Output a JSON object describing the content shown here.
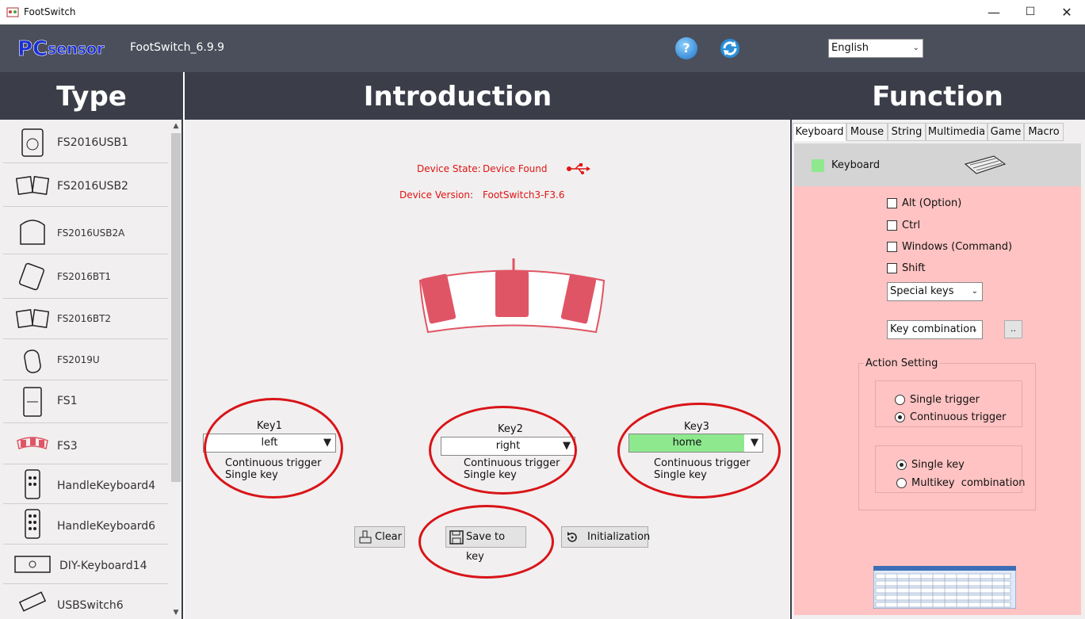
{
  "window": {
    "title": "FootSwitch",
    "minimize": "—",
    "maximize": "☐",
    "close": "✕"
  },
  "header": {
    "logo": "PCsensor",
    "version": "FootSwitch_6.9.9",
    "help": "?",
    "language": "English"
  },
  "columns": {
    "type": "Type",
    "introduction": "Introduction",
    "function": "Function"
  },
  "types": [
    {
      "label": "FS2016USB1"
    },
    {
      "label": "FS2016USB2"
    },
    {
      "label": "FS2016USB2A"
    },
    {
      "label": "FS2016BT1"
    },
    {
      "label": "FS2016BT2"
    },
    {
      "label": "FS2019U"
    },
    {
      "label": "FS1"
    },
    {
      "label": "FS3"
    },
    {
      "label": "HandleKeyboard4"
    },
    {
      "label": "HandleKeyboard6"
    },
    {
      "label": "DIY-Keyboard14"
    },
    {
      "label": "USBSwitch6"
    }
  ],
  "device": {
    "state_label": "Device State:",
    "state_value": "Device Found",
    "version_label": "Device Version:",
    "version_value": "FootSwitch3-F3.6"
  },
  "keys": [
    {
      "title": "Key1",
      "value": "left",
      "trigger": "Continuous trigger",
      "mode": "Single key"
    },
    {
      "title": "Key2",
      "value": "right",
      "trigger": "Continuous trigger",
      "mode": "Single key"
    },
    {
      "title": "Key3",
      "value": "home",
      "trigger": "Continuous trigger",
      "mode": "Single key"
    }
  ],
  "actions": {
    "clear": "Clear",
    "save": "Save to key",
    "init": "Initialization"
  },
  "tabs": [
    "Keyboard",
    "Mouse",
    "String",
    "Multimedia",
    "Game",
    "Macro"
  ],
  "keyboard": {
    "header": "Keyboard",
    "modifiers": [
      "Alt (Option)",
      "Ctrl",
      "Windows (Command)",
      "Shift"
    ],
    "special_keys": "Special keys",
    "key_combination": "Key combination",
    "more": "..",
    "action_setting": "Action Setting",
    "trigger_options": [
      "Single trigger",
      "Continuous trigger"
    ],
    "key_options": [
      "Single key",
      "Multikey  combination"
    ]
  },
  "colors": {
    "accent_red": "#e01414",
    "header_bg": "#4b4f5c",
    "column_bg": "#3b3e49",
    "pedal": "#e05565",
    "function_bg": "#ffc3c3",
    "highlight_green": "#8ee88e"
  }
}
